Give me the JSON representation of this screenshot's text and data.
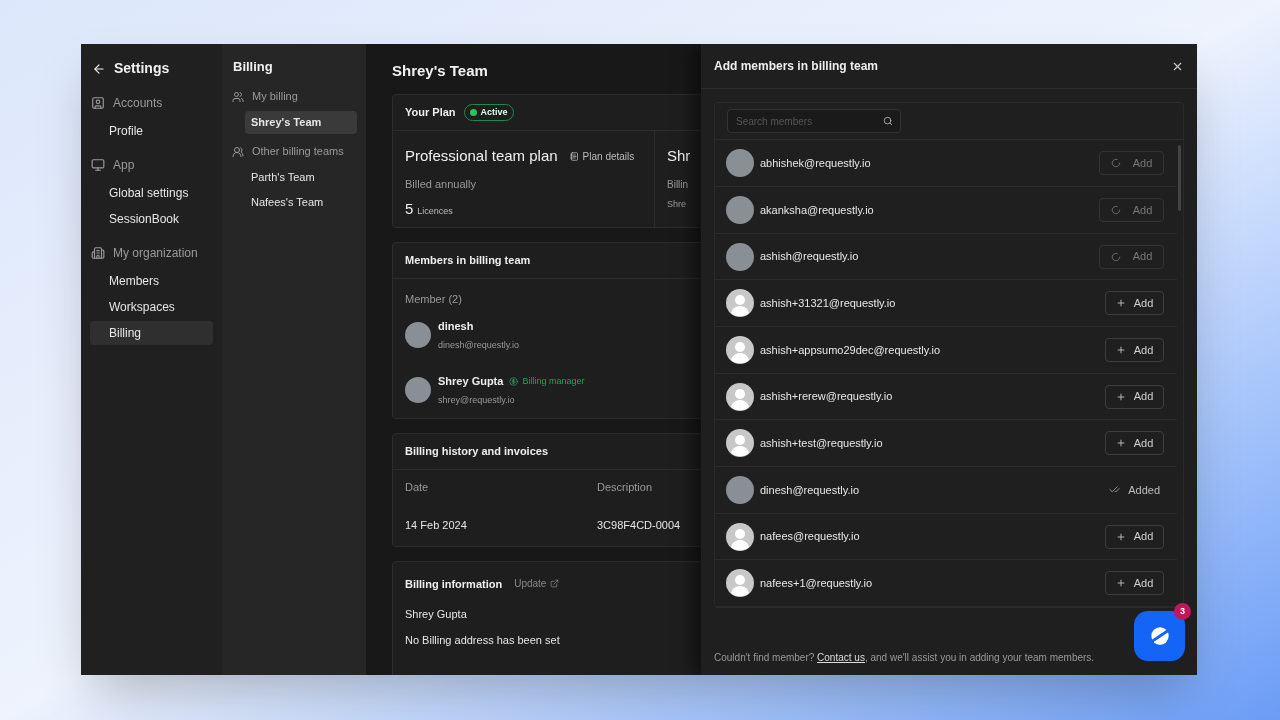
{
  "sidebar": {
    "title": "Settings",
    "sections": [
      {
        "kind": "account",
        "label": "Accounts",
        "items": [
          {
            "label": "Profile",
            "selected": false
          }
        ]
      },
      {
        "kind": "app",
        "label": "App",
        "items": [
          {
            "label": "Global settings",
            "selected": false
          },
          {
            "label": "SessionBook",
            "selected": false
          }
        ]
      },
      {
        "kind": "organization",
        "label": "My organization",
        "items": [
          {
            "label": "Members",
            "selected": false
          },
          {
            "label": "Workspaces",
            "selected": false
          },
          {
            "label": "Billing",
            "selected": true
          }
        ]
      }
    ]
  },
  "subnav": {
    "title": "Billing",
    "groups": [
      {
        "kind": "mine",
        "label": "My billing",
        "items": [
          {
            "label": "Shrey's Team",
            "selected": true
          }
        ]
      },
      {
        "kind": "others",
        "label": "Other billing teams",
        "items": [
          {
            "label": "Parth's Team",
            "selected": false
          },
          {
            "label": "Nafees's Team",
            "selected": false
          }
        ]
      }
    ]
  },
  "main": {
    "title": "Shrey's Team",
    "plan": {
      "heading": "Your Plan",
      "status": "Active",
      "name": "Professional team plan",
      "details_link": "Plan details",
      "billing_cycle": "Billed annually",
      "licence_count": "5",
      "licence_label": "Licences",
      "column_2": [
        "Shr",
        "Billin",
        "Shre"
      ]
    },
    "members": {
      "heading": "Members in billing team",
      "count_label": "Member (2)",
      "items": [
        {
          "name": "dinesh",
          "email": "dinesh@requestly.io"
        },
        {
          "name": "Shrey Gupta",
          "role": "Billing manager",
          "email": "shrey@requestly.io"
        }
      ]
    },
    "history": {
      "heading": "Billing history and invoices",
      "columns": [
        "Date",
        "Description"
      ],
      "rows": [
        [
          "14 Feb 2024",
          "3C98F4CD-0004"
        ]
      ]
    },
    "billing_info": {
      "heading": "Billing information",
      "update_link": "Update",
      "lines": [
        "Shrey Gupta",
        "No Billing address has been set"
      ]
    }
  },
  "drawer": {
    "title": "Add members in billing team",
    "search": {
      "placeholder": "Search members"
    },
    "members": [
      {
        "email": "abhishek@requestly.io",
        "has_photo": true,
        "kind": "loading",
        "action": "Add"
      },
      {
        "email": "akanksha@requestly.io",
        "has_photo": true,
        "kind": "loading",
        "action": "Add"
      },
      {
        "email": "ashish@requestly.io",
        "has_photo": true,
        "kind": "loading",
        "action": "Add"
      },
      {
        "email": "ashish+31321@requestly.io",
        "has_photo": false,
        "kind": "add",
        "action": "Add"
      },
      {
        "email": "ashish+appsumo29dec@requestly.io",
        "has_photo": false,
        "kind": "add",
        "action": "Add"
      },
      {
        "email": "ashish+rerew@requestly.io",
        "has_photo": false,
        "kind": "add",
        "action": "Add"
      },
      {
        "email": "ashish+test@requestly.io",
        "has_photo": false,
        "kind": "add",
        "action": "Add"
      },
      {
        "email": "dinesh@requestly.io",
        "has_photo": true,
        "kind": "added",
        "action": "Added"
      },
      {
        "email": "nafees@requestly.io",
        "has_photo": false,
        "kind": "add",
        "action": "Add"
      },
      {
        "email": "nafees+1@requestly.io",
        "has_photo": false,
        "kind": "add",
        "action": "Add"
      }
    ],
    "footer": {
      "before": "Couldn't find member? ",
      "link": "Contact us",
      "after": ", and we'll assist you in adding your team members."
    }
  },
  "chat": {
    "badge": "3"
  }
}
